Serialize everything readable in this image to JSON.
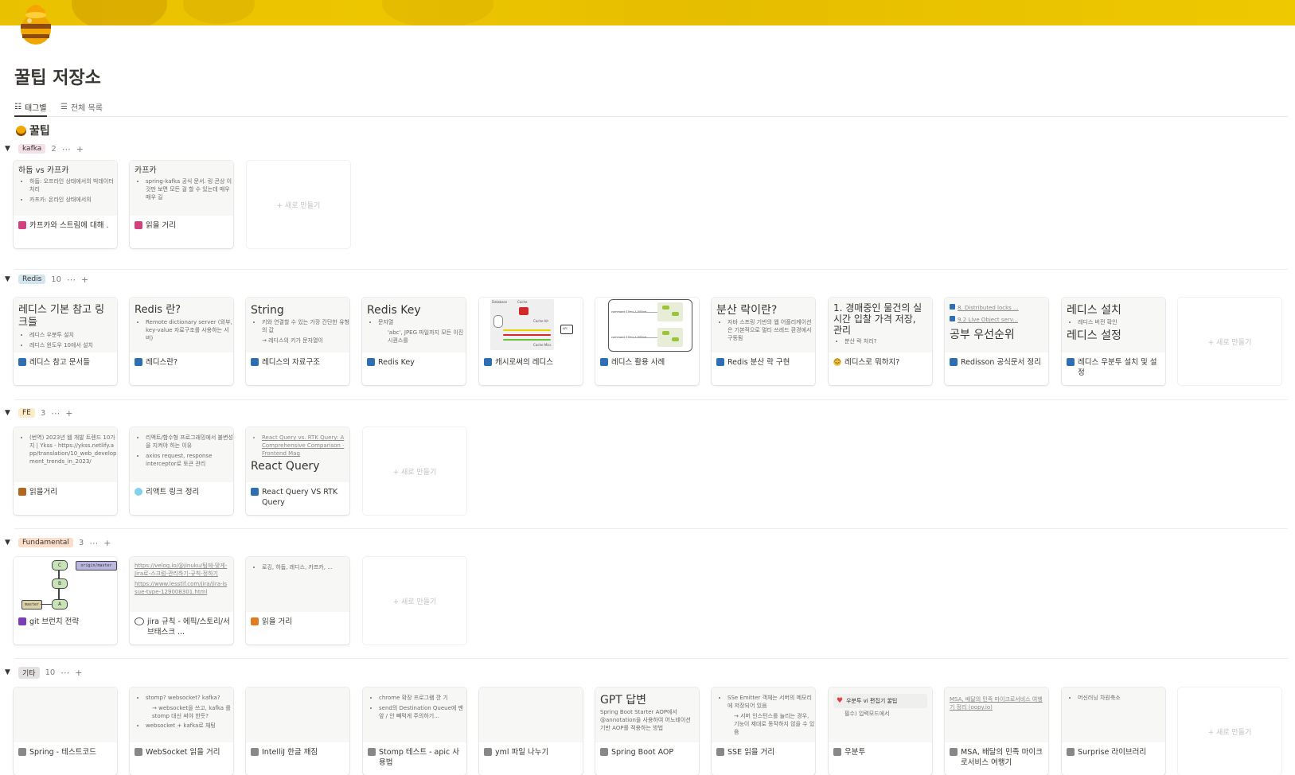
{
  "page": {
    "title": "꿀팁 저장소"
  },
  "views": [
    {
      "label": "태그별"
    },
    {
      "label": "전체 목록"
    }
  ],
  "section": {
    "title": "꿀팁"
  },
  "new_label": "+ 새로 만들기",
  "colors": {
    "cover": "#e9c100",
    "kafka_tag": "#f5e0e9",
    "redis_tag": "#d3e5ef",
    "fe_tag": "#fdecc8",
    "fundamental_tag": "#fadec9",
    "etc_tag": "#e3e2e0"
  },
  "groups": [
    {
      "tag": "kafka",
      "count": "2",
      "cards": [
        {
          "heading": "하둡 vs 카프카",
          "bullets": [
            "하둡: 오프라인 상태에서의 빅데이터 처리",
            "카프카: 온라인 상태에서의"
          ],
          "title": "카프카와 스트림에 대해 ."
        },
        {
          "heading": "카프카",
          "bullets": [
            "spring-kafka 공식 문서. 링 콘상 이것만 보면 모든 걸 할 수 있는데 매우매우 길"
          ],
          "title": "읽을 거리"
        }
      ]
    },
    {
      "tag": "Redis",
      "count": "10",
      "cards": [
        {
          "heading": "레디스 기본 참고 링크들",
          "bullets": [
            "레디스 우분투 설치",
            "레디스 윈도우 10에서 설치"
          ],
          "title": "레디스 참고 문서들"
        },
        {
          "heading": "Redis 란?",
          "bullets": [
            "Remote dictionary server (외부, key-value 자료구조를 사용하는 서버)"
          ],
          "title": "레디스란?"
        },
        {
          "heading": "String",
          "bullets": [
            "키와 연결할 수 있는 가장 간단한 유형의 값"
          ],
          "sub": "→ 레디스의 키가 문자열이",
          "title": "레디스의 자료구조"
        },
        {
          "heading": "Redis Key",
          "bullets": [
            "문자열"
          ],
          "sub": "'abc', JPEG 파일까지 모든 이진 시퀀스를",
          "title": "Redis Key"
        },
        {
          "labels": [
            "Database",
            "Cache",
            "Cache hit",
            "Cache Miss",
            "API"
          ],
          "title": "캐시로써의 레디스"
        },
        {
          "labels": [
            "command 10ms 1.000ms",
            "command 10ms 1.000ms"
          ],
          "title": "레디스 활용 사례"
        },
        {
          "heading": "분산 락이란?",
          "bullets": [
            "자바 스프링 기반의 웹 어플리케이션은 기본적으로 멀티 쓰레드 환경에서 구동됨"
          ],
          "title": "Redis 분산 락 구현"
        },
        {
          "heading": "1. 경매중인 물건의 실시간 입찰 가격 저장, 관리",
          "bullets": [
            "분산 락 처리?"
          ],
          "title": "레디스로 뭐하지?"
        },
        {
          "links": [
            "8. Distributed locks ...",
            "9.2 Live Object serv..."
          ],
          "heading": "공부 우선순위",
          "title": "Redisson 공식문서 정리"
        },
        {
          "heading": "레디스 설치",
          "bullets": [
            "레디스 버전 확인"
          ],
          "heading2": "레디스 설정",
          "title": "레디스 우분투 설치 및 설정"
        }
      ]
    },
    {
      "tag": "FE",
      "count": "3",
      "cards": [
        {
          "bullets": [
            "(번역) 2023년 웹 개발 트렌드 10가지 | Ykss - https://ykss.netlify.app/translation/10_web_development_trends_in_2023/"
          ],
          "title": "읽을거리"
        },
        {
          "bullets": [
            "리액트/함수형 프로그래밍에서 불변성을 지켜야 하는 이유",
            "axios request, response interceptor로 토큰 관리"
          ],
          "title": "리액트 링크 정리"
        },
        {
          "bullets": [
            "React Query vs. RTK Query: A Comprehensive Comparison · Frontend Mag"
          ],
          "heading": "React Query",
          "title": "React Query VS RTK Query"
        }
      ]
    },
    {
      "tag": "Fundamental",
      "count": "3",
      "cards": [
        {
          "labels": [
            "C",
            "origin/master",
            "B",
            "master",
            "A"
          ],
          "title": "git 브런치 전략"
        },
        {
          "links": [
            "https://velog.io/@jinuku/팀에-맞게-Jira로-스크럼-관리하기-규칙-정하기",
            "https://www.lesstif.com/jira/jira-issue-type-129008301.html"
          ],
          "title": "jira 규칙 - 에픽/스토리/서브태스크 ..."
        },
        {
          "bullets": [
            "로깅, 하둡, 레디스, 카프카, ..."
          ],
          "title": "읽을 거리"
        }
      ]
    },
    {
      "tag": "기타",
      "count": "10",
      "cards": [
        {
          "title": "Spring - 테스트코드"
        },
        {
          "bullets": [
            "stomp? websocket? kafka?"
          ],
          "sub": "→ websocket을 쓰고, kafka 를 stomp 대신 써야 한듯?",
          "bullets2": [
            "websocket + kafka로 채팅"
          ],
          "title": "WebSocket 읽을 거리"
        },
        {
          "title": "IntelliJ 한글 깨짐"
        },
        {
          "bullets": [
            "chrome 확장 프로그램 깐 기",
            "send의 Destination Queue에 맨 앞 / 안 빼먹게 주의하기..."
          ],
          "title": "Stomp 테스트 - apic 사용법"
        },
        {
          "title": "yml 파일 나누기"
        },
        {
          "heading": "GPT 답변",
          "plain": "Spring Boot Starter AOP에서 @annotation을 사용하여 어노테이션 기반 AOP를 적용하는 방법",
          "title": "Spring Boot AOP"
        },
        {
          "bullets": [
            "SSe Emitter 객체는 서버의 메모리에 저장되어 있음"
          ],
          "sub": "→ 서버 인스턴스를 늘리는 경우, 기능이 제대로 동작하지 않을 수 있음",
          "title": "SSE 읽을 거리"
        },
        {
          "callout": "우분투 vi 편집기 꿀팁",
          "plain": "필수) 입력모드에서",
          "title": "우분투"
        },
        {
          "links": [
            "MSA, 배달의 민족 마이크로서비스 여행기 정리 (oopy.io)"
          ],
          "title": "MSA, 배달의 민족 마이크로서비스 여행기"
        },
        {
          "bullets": [
            "머신러닝 차원축소"
          ],
          "title": "Surprise 라이브러리"
        }
      ]
    }
  ]
}
